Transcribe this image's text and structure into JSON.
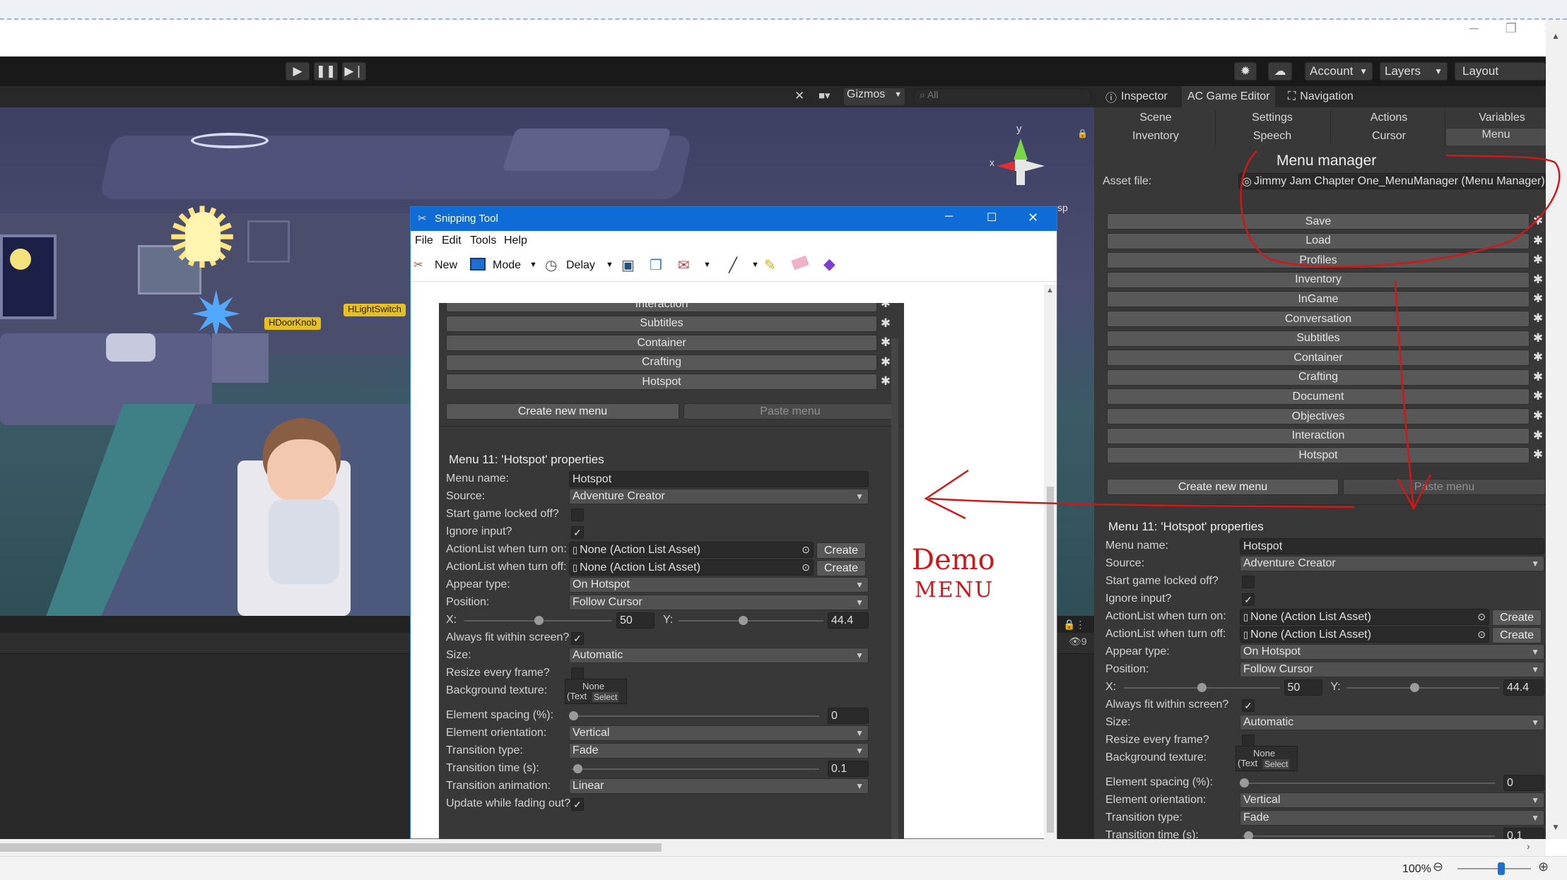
{
  "viewer": {
    "zoom": "100%",
    "zoom_level": 0.6
  },
  "unity": {
    "toolbar": {
      "account": "Account",
      "layers": "Layers",
      "layout": "Layout"
    },
    "scene": {
      "gizmos": "Gizmos",
      "search_placeholder": "All",
      "axis_y": "y",
      "axis_x": "x",
      "persp": "sp",
      "hidden_count": "9"
    },
    "scene_labels": {
      "door": "HDoorKnob",
      "switch": "HLightSwitch"
    }
  },
  "inspector": {
    "tabs": [
      "Inspector",
      "AC Game Editor",
      "Navigation"
    ],
    "editor_tabs_row1": [
      "Scene",
      "Settings",
      "Actions",
      "Variables"
    ],
    "editor_tabs_row2": [
      "Inventory",
      "Speech",
      "Cursor",
      "Menu"
    ],
    "title": "Menu manager",
    "asset_label": "Asset file:",
    "asset_value": "Jimmy Jam Chapter One_MenuManager (Menu Manager)",
    "menus": [
      "Save",
      "Load",
      "Profiles",
      "Inventory",
      "InGame",
      "Conversation",
      "Subtitles",
      "Container",
      "Crafting",
      "Document",
      "Objectives",
      "Interaction",
      "Hotspot"
    ],
    "create_menu": "Create new menu",
    "paste_menu": "Paste menu",
    "props_title": "Menu 11: 'Hotspot' properties"
  },
  "props": {
    "menu_name_label": "Menu name:",
    "menu_name": "Hotspot",
    "source_label": "Source:",
    "source": "Adventure Creator",
    "locked_label": "Start game locked off?",
    "ignore_label": "Ignore input?",
    "al_on_label": "ActionList when turn on:",
    "al_on": "None (Action List Asset)",
    "al_off_label": "ActionList when turn off:",
    "al_off": "None (Action List Asset)",
    "create": "Create",
    "appear_label": "Appear type:",
    "appear": "On Hotspot",
    "position_label": "Position:",
    "position": "Follow Cursor",
    "x_label": "X:",
    "x_value": "50",
    "y_label": "Y:",
    "y_value": "44.4",
    "fit_label": "Always fit within screen?",
    "size_label": "Size:",
    "size": "Automatic",
    "resize_label": "Resize every frame?",
    "bg_label": "Background texture:",
    "bg_none": "None",
    "bg_text": "(Text",
    "bg_select": "Select",
    "spacing_label": "Element spacing (%):",
    "spacing": "0",
    "orient_label": "Element orientation:",
    "orient": "Vertical",
    "transition_label": "Transition type:",
    "transition": "Fade",
    "ttime_label": "Transition time (s):",
    "ttime": "0.1",
    "tanim_label": "Transition animation:",
    "tanim": "Linear",
    "update_label": "Update while fading out?"
  },
  "snip": {
    "title": "Snipping Tool",
    "menu": [
      "File",
      "Edit",
      "Tools",
      "Help"
    ],
    "tools": {
      "new": "New",
      "mode": "Mode",
      "delay": "Delay"
    },
    "menus": [
      "Interaction",
      "Subtitles",
      "Container",
      "Crafting",
      "Hotspot"
    ]
  },
  "annotation": {
    "line1": "Demo",
    "line2": "MENU"
  }
}
